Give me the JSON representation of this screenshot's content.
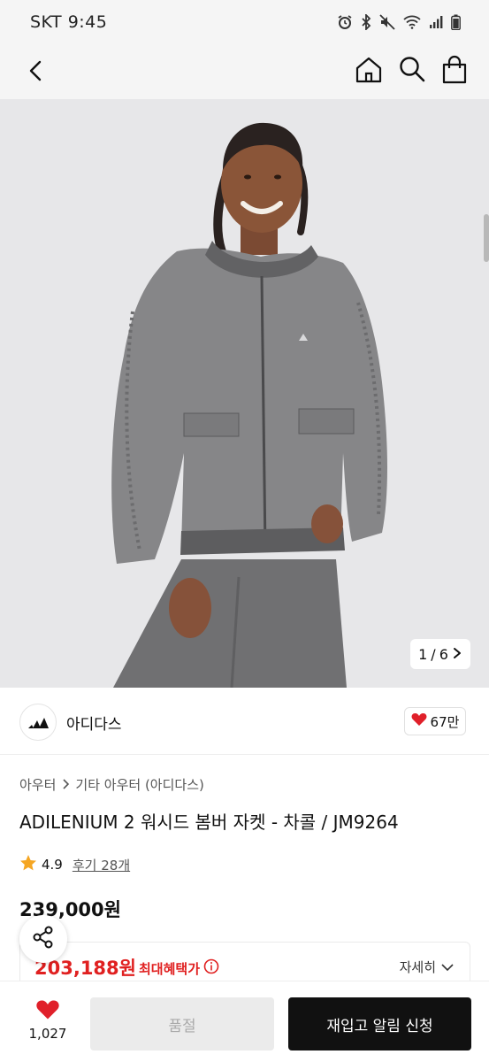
{
  "status_bar": {
    "carrier_time": "SKT 9:45",
    "icons": [
      "alarm-icon",
      "bluetooth-icon",
      "mute-icon",
      "wifi-icon",
      "signal-icon",
      "battery-icon"
    ]
  },
  "nav": {
    "icons": [
      "back-icon",
      "home-icon",
      "search-icon",
      "cart-icon"
    ]
  },
  "gallery": {
    "current": "1",
    "separator": "/",
    "total": "6"
  },
  "brand": {
    "name": "아디다스",
    "likes": "67만"
  },
  "breadcrumb": {
    "level1": "아우터",
    "level2": "기타 아우터 (아디다스)"
  },
  "product": {
    "title": "ADILENIUM 2 워시드 봄버 자켓 - 차콜 / JM9264",
    "rating": "4.9",
    "reviews": "후기 28개",
    "price": "239,000원"
  },
  "benefit": {
    "price": "203,188원",
    "label": "최대혜택가",
    "detail": "자세히"
  },
  "bottom": {
    "wish_count": "1,027",
    "soldout_label": "품절",
    "restock_label": "재입고 알림 신청"
  },
  "colors": {
    "accent_red": "#e02020",
    "heart_red": "#e0202a",
    "star": "#f5a623",
    "cta_black": "#111111"
  }
}
